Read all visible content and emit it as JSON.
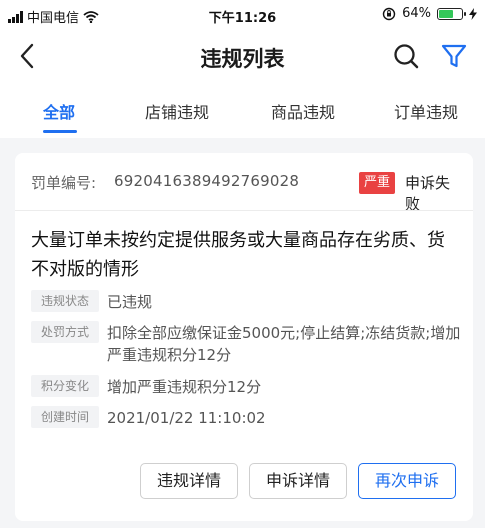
{
  "status_bar": {
    "carrier": "中国电信",
    "time": "下午11:26",
    "battery": "64%",
    "icons": [
      "signal-icon",
      "wifi-icon",
      "rotation-lock-icon",
      "battery-icon",
      "charging-icon"
    ]
  },
  "nav": {
    "title": "违规列表",
    "icons": [
      "back-icon",
      "search-icon",
      "filter-icon"
    ]
  },
  "tabs": [
    {
      "label": "全部",
      "active": true
    },
    {
      "label": "店铺违规",
      "active": false
    },
    {
      "label": "商品违规",
      "active": false
    },
    {
      "label": "订单违规",
      "active": false
    }
  ],
  "card": {
    "order_label": "罚单编号:",
    "order_number": "6920416389492769028",
    "severity_badge": "严重",
    "appeal_status": "申诉失败",
    "violation_title": "大量订单未按约定提供服务或大量商品存在劣质、货不对版的情形",
    "details": [
      {
        "key": "违规状态",
        "value": "已违规"
      },
      {
        "key": "处罚方式",
        "value": "扣除全部应缴保证金5000元;停止结算;冻结货款;增加严重违规积分12分"
      },
      {
        "key": "积分变化",
        "value": "增加严重违规积分12分"
      },
      {
        "key": "创建时间",
        "value": "2021/01/22 11:10:02"
      }
    ],
    "buttons": {
      "violation_detail": "违规详情",
      "appeal_detail": "申诉详情",
      "appeal_again": "再次申诉"
    }
  },
  "colors": {
    "accent": "#1f6ff0",
    "badge": "#e94242",
    "battery": "#34c759"
  }
}
